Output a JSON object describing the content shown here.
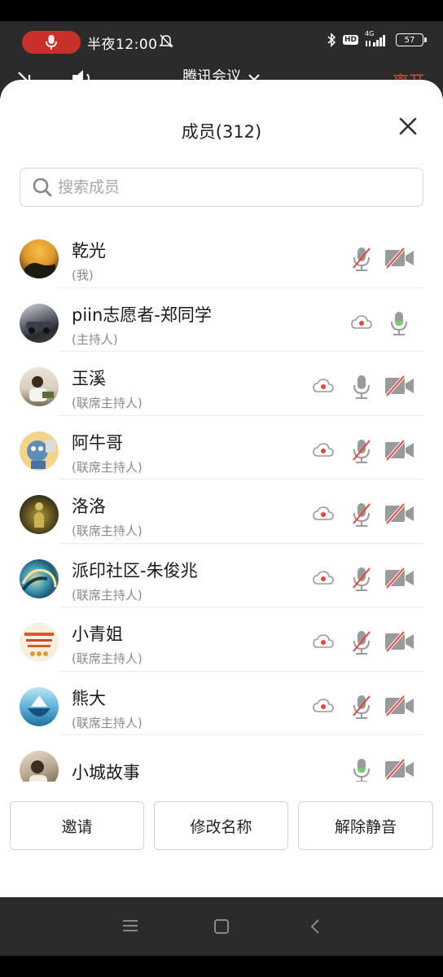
{
  "status_bar": {
    "time": "半夜12:00",
    "network": "4G",
    "battery": "57",
    "hd_badge": "HD"
  },
  "meeting": {
    "title": "腾讯会议",
    "leave": "离开"
  },
  "panel": {
    "title": "成员(312)",
    "search_placeholder": "搜索成员"
  },
  "members": [
    {
      "name": "乾光",
      "role": "(我)",
      "cloud": false,
      "mic": "muted",
      "camera": "off"
    },
    {
      "name": "piin志愿者-郑同学",
      "role": "(主持人)",
      "cloud": true,
      "mic": "on",
      "camera": "none"
    },
    {
      "name": "玉溪",
      "role": "(联席主持人)",
      "cloud": true,
      "mic": "on_gray",
      "camera": "off"
    },
    {
      "name": "阿牛哥",
      "role": "(联席主持人)",
      "cloud": true,
      "mic": "muted",
      "camera": "off"
    },
    {
      "name": "洛洛",
      "role": "(联席主持人)",
      "cloud": true,
      "mic": "muted",
      "camera": "off"
    },
    {
      "name": "派印社区-朱俊兆",
      "role": "(联席主持人)",
      "cloud": true,
      "mic": "muted",
      "camera": "off"
    },
    {
      "name": "小青姐",
      "role": "(联席主持人)",
      "cloud": true,
      "mic": "muted",
      "camera": "off"
    },
    {
      "name": "熊大",
      "role": "(联席主持人)",
      "cloud": true,
      "mic": "muted",
      "camera": "off"
    },
    {
      "name": "小城故事",
      "role": "",
      "cloud": false,
      "mic": "on",
      "camera": "off"
    }
  ],
  "actions": {
    "invite": "邀请",
    "rename": "修改名称",
    "unmute": "解除静音"
  },
  "colors": {
    "accent_red": "#e5453b",
    "mic_green": "#7bc97b",
    "icon_gray": "#9a9a9a"
  }
}
